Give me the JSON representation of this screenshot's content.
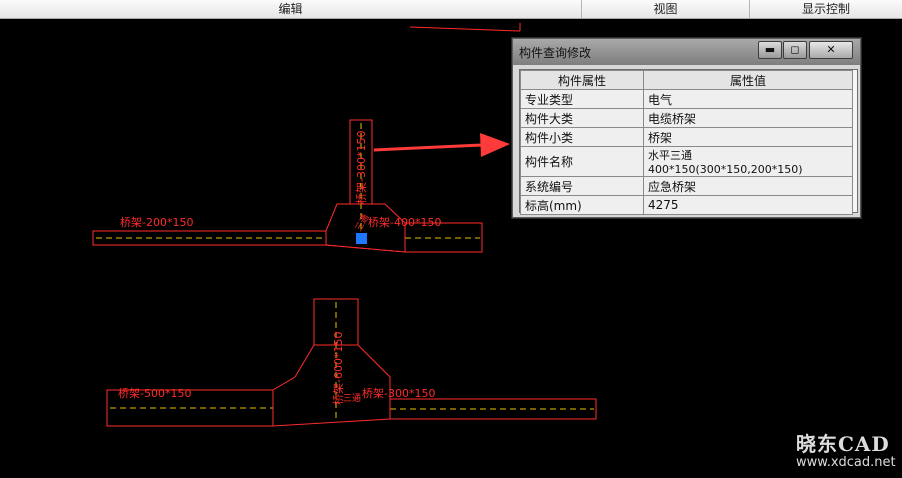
{
  "menubar": {
    "items": [
      "编辑",
      "视图",
      "显示控制"
    ]
  },
  "drawing": {
    "tee_upper": {
      "left_label": "桥架-200*150",
      "right_label": "桥架-400*150",
      "vertical_label": "桥架-300*150",
      "tee_label": "三通"
    },
    "tee_lower": {
      "left_label": "桥架-500*150",
      "right_label": "桥架-300*150",
      "vertical_label": "桥架-600*150",
      "tee_label": "三通"
    }
  },
  "dialog": {
    "title": "构件查询修改",
    "minimize_glyph": "▬",
    "maximize_glyph": "◻",
    "close_glyph": "✕",
    "headers": [
      "构件属性",
      "属性值"
    ],
    "rows": [
      {
        "key": "专业类型",
        "value": "电气"
      },
      {
        "key": "构件大类",
        "value": "电缆桥架"
      },
      {
        "key": "构件小类",
        "value": "桥架"
      },
      {
        "key": "构件名称",
        "value": "水平三通 400*150(300*150,200*150)"
      },
      {
        "key": "系统编号",
        "value": "应急桥架"
      },
      {
        "key": "标高(mm)",
        "value": "4275"
      }
    ]
  },
  "watermark": {
    "logo": "晓东CAD",
    "url": "www.xdcad.net"
  },
  "colors": {
    "cad_line": "#ff2b2b",
    "dash_line": "#e8c000",
    "grip": "#1e78ff",
    "arrow": "#ff3a3a"
  }
}
